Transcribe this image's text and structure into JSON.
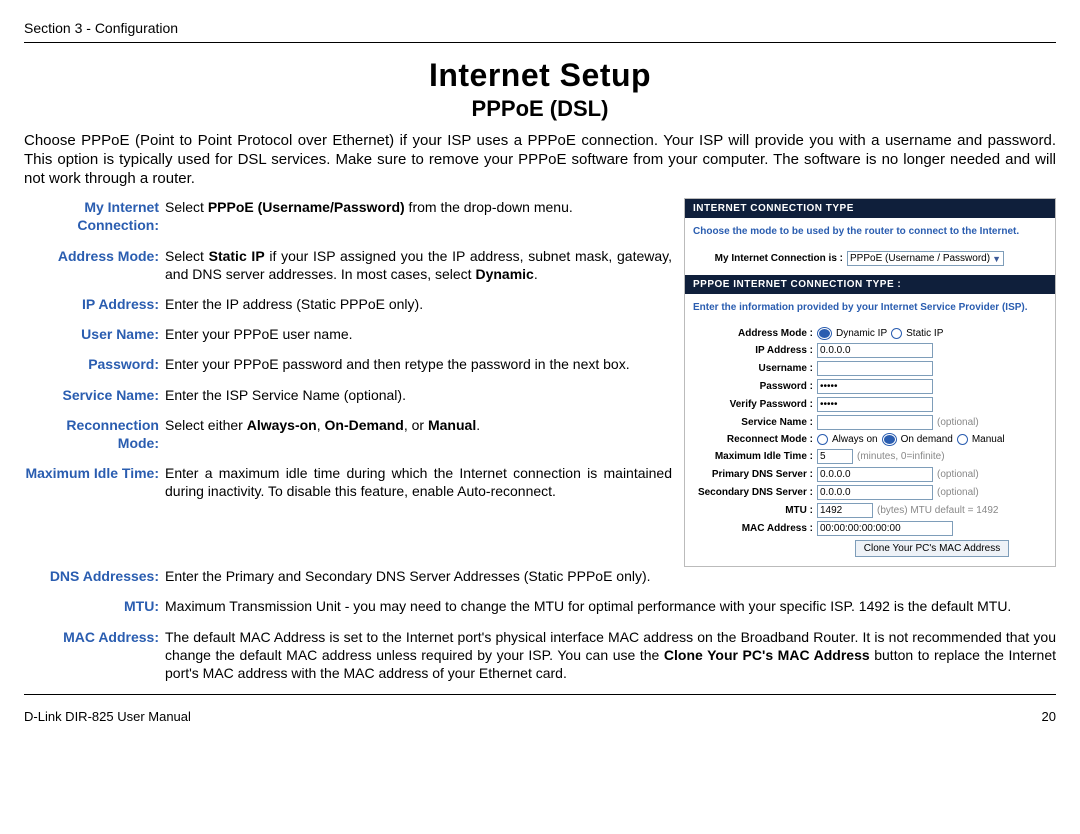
{
  "header": {
    "section": "Section 3 - Configuration"
  },
  "heading": {
    "title": "Internet Setup",
    "subtitle": "PPPoE (DSL)"
  },
  "intro": "Choose PPPoE (Point to Point Protocol over Ethernet) if your ISP uses a PPPoE connection. Your ISP will provide you with a username and password. This option is typically used for DSL services. Make sure to remove your PPPoE software from your computer. The software is no longer needed and will not work through a router.",
  "defs": [
    {
      "label": "My Internet Connection:",
      "desc_parts": [
        {
          "t": "Select "
        },
        {
          "t": "PPPoE (Username/Password)",
          "b": true
        },
        {
          "t": " from the drop-down menu."
        }
      ]
    },
    {
      "label": "Address Mode:",
      "desc_parts": [
        {
          "t": "Select "
        },
        {
          "t": "Static IP",
          "b": true
        },
        {
          "t": " if your ISP assigned you the IP address, subnet mask, gateway, and DNS server addresses. In most cases, select "
        },
        {
          "t": "Dynamic",
          "b": true
        },
        {
          "t": "."
        }
      ]
    },
    {
      "label": "IP Address:",
      "desc_parts": [
        {
          "t": "Enter the IP address (Static PPPoE only)."
        }
      ]
    },
    {
      "label": "User Name:",
      "desc_parts": [
        {
          "t": "Enter your PPPoE user name."
        }
      ]
    },
    {
      "label": "Password:",
      "desc_parts": [
        {
          "t": "Enter your PPPoE password and then retype the password in the next box."
        }
      ]
    },
    {
      "label": "Service Name:",
      "desc_parts": [
        {
          "t": "Enter the ISP Service Name (optional)."
        }
      ]
    },
    {
      "label": "Reconnection Mode:",
      "desc_parts": [
        {
          "t": "Select either "
        },
        {
          "t": "Always-on",
          "b": true
        },
        {
          "t": ", "
        },
        {
          "t": "On-Demand",
          "b": true
        },
        {
          "t": ", or "
        },
        {
          "t": "Manual",
          "b": true
        },
        {
          "t": "."
        }
      ]
    },
    {
      "label": "Maximum Idle Time:",
      "desc_parts": [
        {
          "t": "Enter a maximum idle time during which the Internet connection is maintained during inactivity. To disable this feature, enable Auto-reconnect."
        }
      ]
    }
  ],
  "full_defs": [
    {
      "label": "DNS Addresses:",
      "desc_parts": [
        {
          "t": "Enter the Primary and Secondary DNS Server Addresses (Static PPPoE only)."
        }
      ]
    },
    {
      "label": "MTU:",
      "desc_parts": [
        {
          "t": "Maximum Transmission Unit - you may need to change the MTU for optimal performance with your specific ISP. 1492 is the default MTU."
        }
      ]
    },
    {
      "label": "MAC Address:",
      "desc_parts": [
        {
          "t": "The default MAC Address is set to the Internet port's physical interface MAC address on the Broadband Router. It is not recommended that you change the default MAC address unless required by your ISP.  You can use the "
        },
        {
          "t": "Clone Your PC's MAC Address",
          "b": true
        },
        {
          "t": " button to replace the Internet port's MAC address with the MAC address of your Ethernet card."
        }
      ]
    }
  ],
  "panel": {
    "section1_header": "INTERNET CONNECTION TYPE",
    "section1_inst": "Choose the mode to be used by the router to connect to the Internet.",
    "conn_label": "My Internet Connection is :",
    "conn_value": "PPPoE (Username / Password)",
    "section2_header": "PPPOE INTERNET CONNECTION TYPE :",
    "section2_inst": "Enter the information provided by your Internet Service Provider (ISP).",
    "fields": {
      "address_mode": {
        "label": "Address Mode :",
        "opt1": "Dynamic IP",
        "opt2": "Static IP"
      },
      "ip": {
        "label": "IP Address :",
        "value": "0.0.0.0"
      },
      "user": {
        "label": "Username :",
        "value": ""
      },
      "pass": {
        "label": "Password :",
        "mask": "•••••"
      },
      "verify": {
        "label": "Verify Password :",
        "mask": "•••••"
      },
      "service": {
        "label": "Service Name :",
        "value": "",
        "note": "(optional)"
      },
      "reconnect": {
        "label": "Reconnect Mode :",
        "opt1": "Always on",
        "opt2": "On demand",
        "opt3": "Manual"
      },
      "idle": {
        "label": "Maximum Idle Time :",
        "value": "5",
        "note": "(minutes, 0=infinite)"
      },
      "dns1": {
        "label": "Primary DNS Server :",
        "value": "0.0.0.0",
        "note": "(optional)"
      },
      "dns2": {
        "label": "Secondary DNS Server :",
        "value": "0.0.0.0",
        "note": "(optional)"
      },
      "mtu": {
        "label": "MTU :",
        "value": "1492",
        "note": "(bytes) MTU default = 1492"
      },
      "mac": {
        "label": "MAC Address :",
        "value": "00:00:00:00:00:00"
      }
    },
    "clone_btn": "Clone Your PC's MAC Address"
  },
  "footer": {
    "left": "D-Link DIR-825 User Manual",
    "right": "20"
  }
}
